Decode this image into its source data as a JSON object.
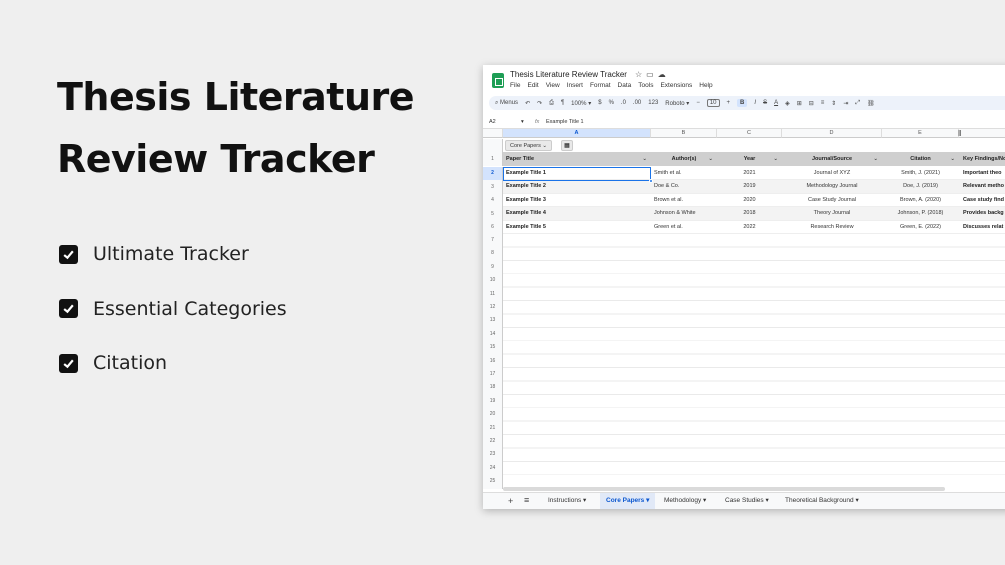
{
  "promo": {
    "title_line1": "Thesis Literature",
    "title_line2": "Review Tracker",
    "features": [
      "Ultimate Tracker",
      "Essential Categories",
      "Citation"
    ]
  },
  "sheet": {
    "doc_title": "Thesis Literature Review Tracker",
    "menu": [
      "File",
      "Edit",
      "View",
      "Insert",
      "Format",
      "Data",
      "Tools",
      "Extensions",
      "Help"
    ],
    "toolbar": {
      "menus_label": "Menus",
      "zoom": "100%",
      "currency": "$",
      "percent": "%",
      "dec_minus": ".0",
      "dec_plus": ".00",
      "number_format": "123",
      "font": "Roboto",
      "font_size": "10",
      "bold": "B",
      "italic": "I",
      "strike": "S",
      "text_color": "A"
    },
    "name_box": "A2",
    "fx": "fx",
    "formula_content": "Example Title 1",
    "columns": [
      "A",
      "B",
      "C",
      "D",
      "E"
    ],
    "view_tab": "Core Papers",
    "headers": [
      "Paper Title",
      "Author(s)",
      "Year",
      "Journal/Source",
      "Citation",
      "Key Findings/No"
    ],
    "rows": [
      [
        "Example Title 1",
        "Smith et al.",
        "2021",
        "Journal of XYZ",
        "Smith, J. (2021)",
        "Important theo"
      ],
      [
        "Example Title 2",
        "Doe & Co.",
        "2019",
        "Methodology Journal",
        "Doe, J. (2019)",
        "Relevant metho"
      ],
      [
        "Example Title 3",
        "Brown et al.",
        "2020",
        "Case Study Journal",
        "Brown, A. (2020)",
        "Case study find"
      ],
      [
        "Example Title 4",
        "Johnson & White",
        "2018",
        "Theory Journal",
        "Johnson, P. (2018)",
        "Provides backg"
      ],
      [
        "Example Title 5",
        "Green et al.",
        "2022",
        "Research Review",
        "Green, E. (2022)",
        "Discusses relat"
      ]
    ],
    "row_numbers": [
      "1",
      "2",
      "3",
      "4",
      "5",
      "6",
      "7",
      "8",
      "9",
      "10",
      "11",
      "12",
      "13",
      "14",
      "15",
      "16",
      "17",
      "18",
      "19",
      "20",
      "21",
      "22",
      "23",
      "24",
      "25"
    ],
    "sheet_tabs": [
      "Instructions",
      "Core Papers",
      "Methodology",
      "Case Studies",
      "Theoretical Background"
    ],
    "active_tab": "Core Papers"
  },
  "colors": {
    "accent": "#1a73e8",
    "sheets_green": "#1e9e55",
    "header_fill": "#cfcfcf",
    "background": "#efefef"
  }
}
